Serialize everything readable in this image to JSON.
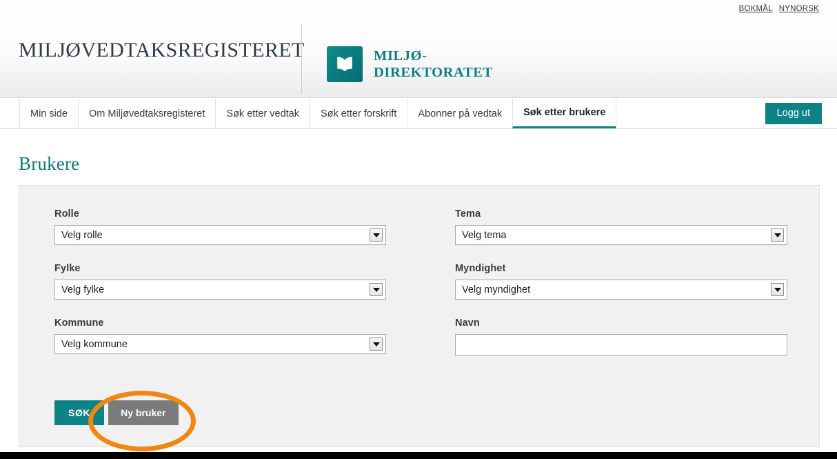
{
  "language_bar": {
    "links": [
      {
        "label": "BOKMÅL",
        "name": "lang-bokmal"
      },
      {
        "label": "NYNORSK",
        "name": "lang-nynorsk"
      }
    ]
  },
  "header": {
    "site_title": "MILJØVEDTAKSREGISTERET",
    "brand_line1": "MILJØ-",
    "brand_line2": "DIREKTORATET",
    "brand_icon": "open-book-icon",
    "brand_color": "#0d7e84"
  },
  "nav": {
    "items": [
      {
        "label": "Min side",
        "active": false
      },
      {
        "label": "Om Miljøvedtaksregisteret",
        "active": false
      },
      {
        "label": "Søk etter vedtak",
        "active": false
      },
      {
        "label": "Søk etter forskrift",
        "active": false
      },
      {
        "label": "Abonner på vedtak",
        "active": false
      },
      {
        "label": "Søk etter brukere",
        "active": true
      }
    ],
    "logout_label": "Logg ut",
    "accent_color": "#0d8387"
  },
  "main": {
    "page_title": "Brukere",
    "form": {
      "rolle": {
        "label": "Rolle",
        "value": "Velg rolle"
      },
      "tema": {
        "label": "Tema",
        "value": "Velg tema"
      },
      "fylke": {
        "label": "Fylke",
        "value": "Velg fylke"
      },
      "myndighet": {
        "label": "Myndighet",
        "value": "Velg myndighet"
      },
      "kommune": {
        "label": "Kommune",
        "value": "Velg kommune"
      },
      "navn": {
        "label": "Navn",
        "value": "",
        "placeholder": ""
      }
    },
    "actions": {
      "search_label": "SØK",
      "new_user_label": "Ny bruker"
    }
  },
  "annotation": {
    "shape": "ellipse-highlight",
    "color": "#f08712",
    "target": "Ny bruker"
  }
}
